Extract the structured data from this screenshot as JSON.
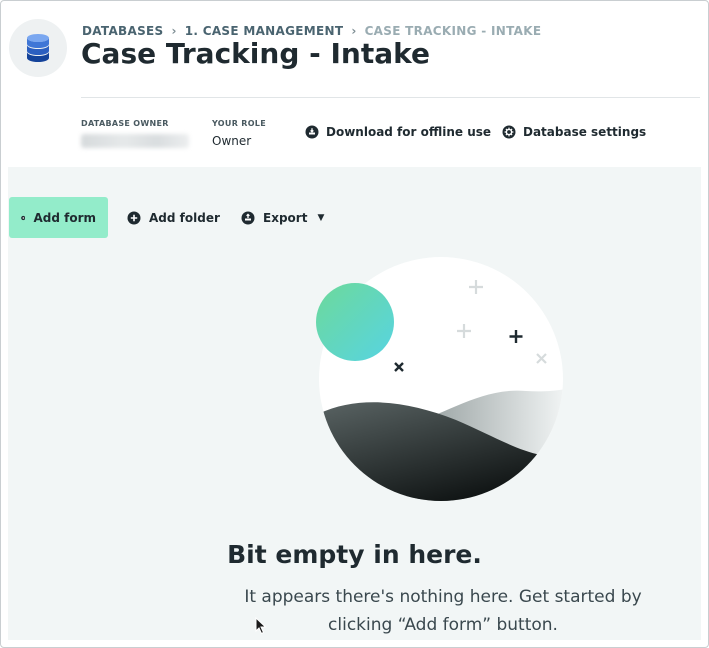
{
  "header": {
    "breadcrumb": [
      "DATABASES",
      "1. CASE MANAGEMENT",
      "CASE TRACKING - INTAKE"
    ],
    "title": "Case Tracking - Intake",
    "icon": "database-icon"
  },
  "meta": {
    "owner_label": "DATABASE OWNER",
    "owner_value_redacted": true,
    "role_label": "YOUR ROLE",
    "role_value": "Owner",
    "download_label": "Download for offline use",
    "download_icon": "download-icon",
    "settings_label": "Database settings",
    "settings_icon": "gear-icon"
  },
  "toolbar": {
    "add_form_label": "Add form",
    "add_folder_label": "Add folder",
    "export_label": "Export"
  },
  "empty_state": {
    "title": "Bit empty in here.",
    "description": "It appears there's nothing here. Get started by clicking “Add form” button."
  },
  "colors": {
    "accent": "#93ecca",
    "panel_bg": "#f2f6f6",
    "text": "#1f2a30",
    "db_icon": "#1d4fa8"
  }
}
